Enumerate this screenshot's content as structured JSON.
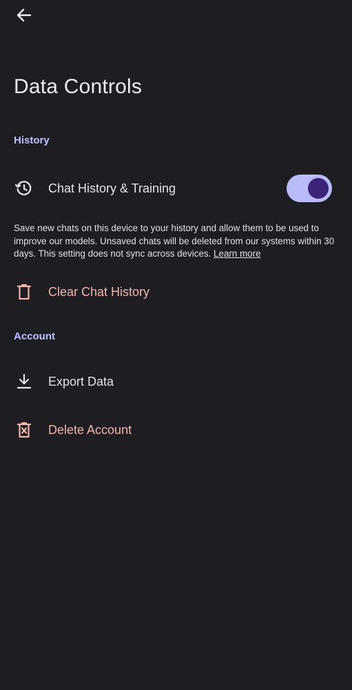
{
  "header": {
    "back_icon": "arrow-left-icon",
    "title": "Data Controls"
  },
  "sections": {
    "history": {
      "title": "History",
      "chat_history_toggle": {
        "label": "Chat History & Training",
        "icon": "history-clock-icon",
        "enabled": true
      },
      "description": {
        "text": "Save new chats on this device to your history and allow them to be used to improve our models. Unsaved chats will be deleted from our systems within 30 days. This setting does not sync across devices.",
        "link": "Learn more"
      },
      "clear_history": {
        "label": "Clear Chat History",
        "icon": "trash-icon"
      }
    },
    "account": {
      "title": "Account",
      "export_data": {
        "label": "Export Data",
        "icon": "download-icon"
      },
      "delete_account": {
        "label": "Delete Account",
        "icon": "delete-box-icon"
      }
    }
  },
  "colors": {
    "background": "#1e1d22",
    "section_header": "#bdc1ff",
    "danger_text": "#f2b6ad",
    "toggle_track": "#b9bcf8",
    "toggle_knob": "#3a2378"
  }
}
